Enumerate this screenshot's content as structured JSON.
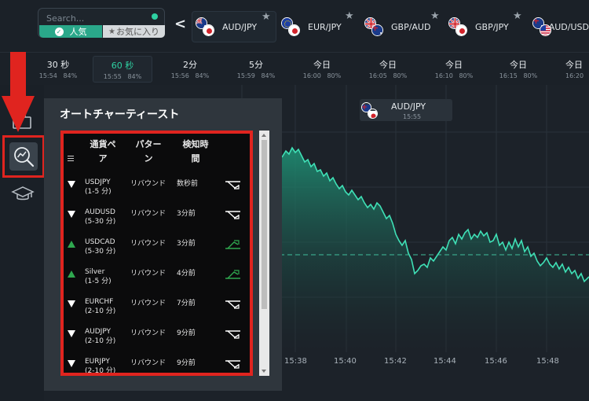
{
  "search": {
    "placeholder": "Search..."
  },
  "asset_tabs": {
    "popular": "人気",
    "favorites": "お気に入り"
  },
  "pairs": [
    {
      "name": "AUD/JPY",
      "active": true
    },
    {
      "name": "EUR/JPY",
      "active": false
    },
    {
      "name": "GBP/AUD",
      "active": false
    },
    {
      "name": "GBP/JPY",
      "active": false
    },
    {
      "name": "AUD/USD",
      "active": false
    }
  ],
  "timeframes": [
    {
      "label": "30 秒",
      "time": "15:54",
      "payout": "84%"
    },
    {
      "label": "60 秒",
      "time": "15:55",
      "payout": "84%"
    },
    {
      "label": "2分",
      "time": "15:56",
      "payout": "84%"
    },
    {
      "label": "5分",
      "time": "15:59",
      "payout": "84%"
    },
    {
      "label": "今日",
      "time": "16:00",
      "payout": "80%"
    },
    {
      "label": "今日",
      "time": "16:05",
      "payout": "80%"
    },
    {
      "label": "今日",
      "time": "16:10",
      "payout": "80%"
    },
    {
      "label": "今日",
      "time": "16:15",
      "payout": "80%"
    },
    {
      "label": "今日",
      "time": "16:20",
      "payout": ""
    }
  ],
  "chart_badge": {
    "pair": "AUD/JPY",
    "time": "15:55"
  },
  "time_axis": [
    "15:38",
    "15:40",
    "15:42",
    "15:44",
    "15:46",
    "15:48"
  ],
  "panel": {
    "title": "オートチャーティースト",
    "headers": {
      "pair_line1": "通貨ペ",
      "pair_line2": "ア",
      "pattern_line1": "パター",
      "pattern_line2": "ン",
      "time_line1": "検知時",
      "time_line2": "間"
    },
    "rows": [
      {
        "dir": "down",
        "pair": "USDJPY",
        "range": "(1-5 分)",
        "pattern": "リバウンド",
        "when": "数秒前"
      },
      {
        "dir": "down",
        "pair": "AUDUSD",
        "range": "(5-30 分)",
        "pattern": "リバウンド",
        "when": "3分前"
      },
      {
        "dir": "up",
        "pair": "USDCAD",
        "range": "(5-30 分)",
        "pattern": "リバウンド",
        "when": "3分前"
      },
      {
        "dir": "up",
        "pair": "Silver",
        "range": "(1-5 分)",
        "pattern": "リバウンド",
        "when": "4分前"
      },
      {
        "dir": "down",
        "pair": "EURCHF",
        "range": "(2-10 分)",
        "pattern": "リバウンド",
        "when": "7分前"
      },
      {
        "dir": "down",
        "pair": "AUDJPY",
        "range": "(2-10 分)",
        "pattern": "リバウンド",
        "when": "9分前"
      },
      {
        "dir": "down",
        "pair": "EURJPY",
        "range": "(2-10 分)",
        "pattern": "リバウンド",
        "when": "9分前"
      }
    ]
  },
  "colors": {
    "accent": "#2ed1a2",
    "highlight_red": "#e0241f",
    "chart_line": "#3fe0b6",
    "up": "#2fa84f",
    "down": "#ffffff"
  }
}
